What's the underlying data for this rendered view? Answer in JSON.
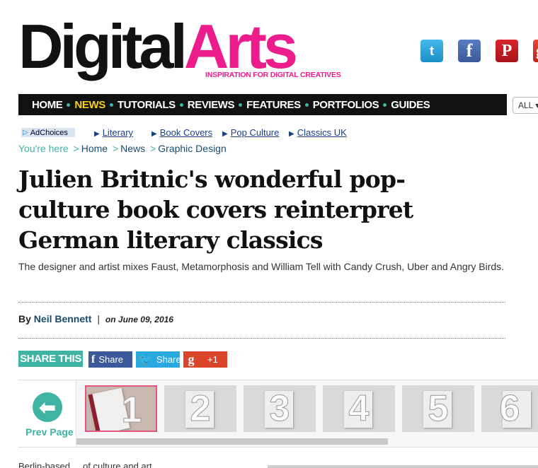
{
  "logo": {
    "part1": "Digital",
    "part2": "Arts",
    "tagline": "INSPIRATION FOR DIGITAL CREATIVES"
  },
  "social": {
    "twitter_glyph": "t",
    "facebook_glyph": "f",
    "pinterest_glyph": "P",
    "googleplus_glyph": "g"
  },
  "nav": {
    "items": [
      {
        "label": "HOME",
        "active": false
      },
      {
        "label": "NEWS",
        "active": true
      },
      {
        "label": "TUTORIALS",
        "active": false
      },
      {
        "label": "REVIEWS",
        "active": false
      },
      {
        "label": "FEATURES",
        "active": false
      },
      {
        "label": "PORTFOLIOS",
        "active": false
      },
      {
        "label": "GUIDES",
        "active": false
      }
    ],
    "select_value": "ALL ▾"
  },
  "ads": {
    "adchoices": "AdChoices",
    "links": [
      "Literary",
      "Book Covers",
      "Pop Culture",
      "Classics UK"
    ]
  },
  "breadcrumb": {
    "prefix": "You're here",
    "items": [
      "Home",
      "News",
      "Graphic Design"
    ],
    "separator": ">"
  },
  "article": {
    "headline": "Julien Britnic's wonderful pop-culture book covers reinterpret German literary classics",
    "standfirst": "The designer and artist mixes Faust, Metamorphosis and William Tell with Candy Crush, Uber and Angry Birds.",
    "by": "By",
    "author": "Neil Bennett",
    "date_prefix": "on",
    "date": "June 09, 2016"
  },
  "share": {
    "label": "SHARE THIS",
    "facebook": "Share",
    "twitter": "Share",
    "googleplus": "+1"
  },
  "gallery": {
    "prev_label": "Prev Page",
    "thumbs": [
      "1",
      "2",
      "3",
      "4",
      "5",
      "6"
    ]
  },
  "body_start": "Berlin-based ... of culture and art ..."
}
